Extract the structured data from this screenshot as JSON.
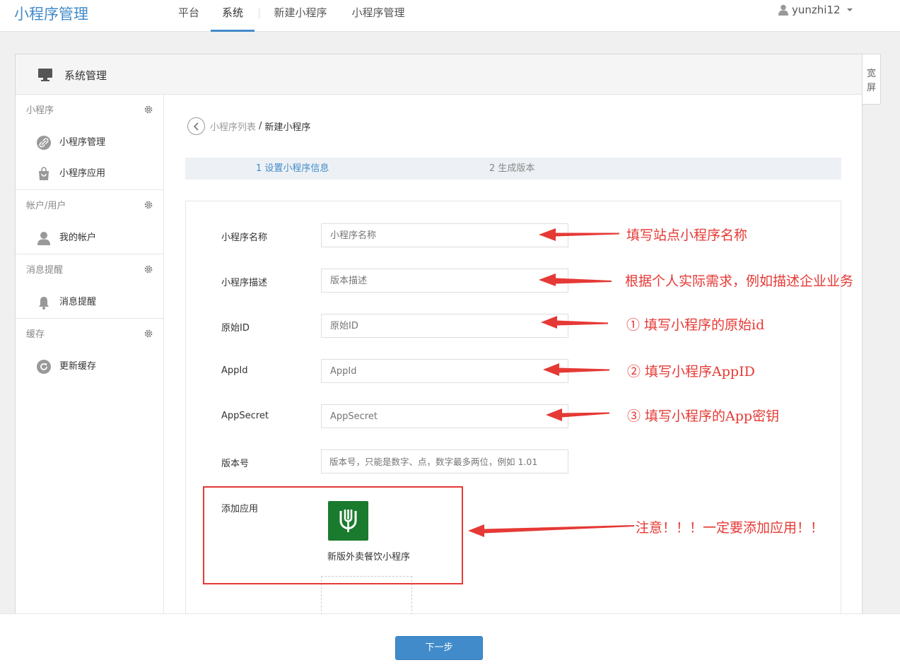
{
  "app": {
    "brand": "小程序管理"
  },
  "topnav": {
    "items": [
      "平台",
      "系统",
      "新建小程序",
      "小程序管理"
    ],
    "active": "系统",
    "user": "yunzhi12"
  },
  "panel": {
    "title": "系统管理",
    "wide_toggle": "宽屏"
  },
  "sidebar": {
    "groups": [
      {
        "title": "小程序",
        "items": [
          {
            "label": "小程序管理",
            "icon": "link-icon"
          },
          {
            "label": "小程序应用",
            "icon": "bag-icon"
          }
        ]
      },
      {
        "title": "帐户/用户",
        "items": [
          {
            "label": "我的帐户",
            "icon": "user-icon"
          }
        ]
      },
      {
        "title": "消息提醒",
        "items": [
          {
            "label": "消息提醒",
            "icon": "bell-icon"
          }
        ]
      },
      {
        "title": "缓存",
        "items": [
          {
            "label": "更新缓存",
            "icon": "refresh-icon"
          }
        ]
      }
    ]
  },
  "breadcrumb": {
    "parent": "小程序列表",
    "separator": "/",
    "current": "新建小程序"
  },
  "steps": {
    "step1": "1 设置小程序信息",
    "step2": "2 生成版本"
  },
  "form": {
    "fields": [
      {
        "label": "小程序名称",
        "placeholder": "小程序名称"
      },
      {
        "label": "小程序描述",
        "placeholder": "版本描述"
      },
      {
        "label": "原始ID",
        "placeholder": "原始ID"
      },
      {
        "label": "AppId",
        "placeholder": "AppId"
      },
      {
        "label": "AppSecret",
        "placeholder": "AppSecret"
      },
      {
        "label": "版本号",
        "placeholder": "版本号，只能是数字、点，数字最多两位，例如 1.01"
      }
    ],
    "add_app_label": "添加应用",
    "app_name": "新版外卖餐饮小程序"
  },
  "annotations": {
    "name": "填写站点小程序名称",
    "desc": "根据个人实际需求，例如描述企业业务",
    "raw_id": "① 填写小程序的原始id",
    "appid": "② 填写小程序AppID",
    "secret": "③ 填写小程序的App密钥",
    "notice": "注意！！！一定要添加应用！！",
    "color": "#e53935"
  },
  "footer": {
    "next_label": "下一步"
  },
  "colors": {
    "primary": "#428bca",
    "app_tile": "#1a7a2e"
  }
}
